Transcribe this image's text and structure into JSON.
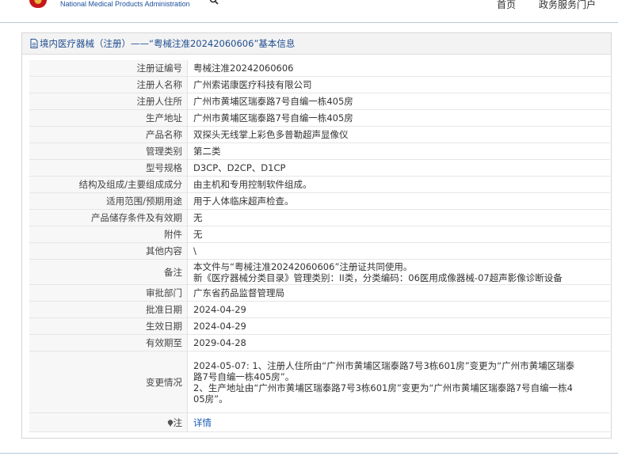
{
  "header": {
    "org_name": "National Medical Products Administration",
    "nav": [
      "首页",
      "政务服务门户"
    ]
  },
  "panel": {
    "title": "境内医疗器械（注册）——“粤械注准20242060606”基本信息",
    "rows": [
      {
        "k": "注册证编号",
        "v": [
          "粤械注准20242060606"
        ]
      },
      {
        "k": "注册人名称",
        "v": [
          "广州索诺康医疗科技有限公司"
        ]
      },
      {
        "k": "注册人住所",
        "v": [
          "广州市黄埔区瑞泰路7号自编一栋405房"
        ]
      },
      {
        "k": "生产地址",
        "v": [
          "广州市黄埔区瑞泰路7号自编一栋405房"
        ]
      },
      {
        "k": "产品名称",
        "v": [
          "双探头无线掌上彩色多普勒超声显像仪"
        ]
      },
      {
        "k": "管理类别",
        "v": [
          "第二类"
        ]
      },
      {
        "k": "型号规格",
        "v": [
          "D3CP、D2CP、D1CP"
        ]
      },
      {
        "k": "结构及组成/主要组成成分",
        "v": [
          "由主机和专用控制软件组成。"
        ]
      },
      {
        "k": "适用范围/预期用途",
        "v": [
          "用于人体临床超声检查。"
        ]
      },
      {
        "k": "产品储存条件及有效期",
        "v": [
          "无"
        ]
      },
      {
        "k": "附件",
        "v": [
          "无"
        ]
      },
      {
        "k": "其他内容",
        "v": [
          "\\"
        ]
      },
      {
        "k": "备注",
        "v": [
          "本文件与“粤械注准20242060606”注册证共同使用。",
          "新《医疗器械分类目录》管理类别：II类，分类编码：06医用成像器械-07超声影像诊断设备"
        ]
      },
      {
        "k": "审批部门",
        "v": [
          "广东省药品监督管理局"
        ]
      },
      {
        "k": "批准日期",
        "v": [
          "2024-04-29"
        ]
      },
      {
        "k": "生效日期",
        "v": [
          "2024-04-29"
        ]
      },
      {
        "k": "有效期至",
        "v": [
          "2029-04-28"
        ]
      },
      {
        "k": "变更情况",
        "v": [
          "2024-05-07: 1、注册人住所由“广州市黄埔区瑞泰路7号3栋601房”变更为“广州市黄埔区瑞泰",
          "路7号自编一栋405房”。",
          "2、生产地址由“广州市黄埔区瑞泰路7号3栋601房”变更为“广州市黄埔区瑞泰路7号自编一栋4",
          "05房”。"
        ]
      }
    ],
    "note_label": "注",
    "note_link": "详情"
  }
}
